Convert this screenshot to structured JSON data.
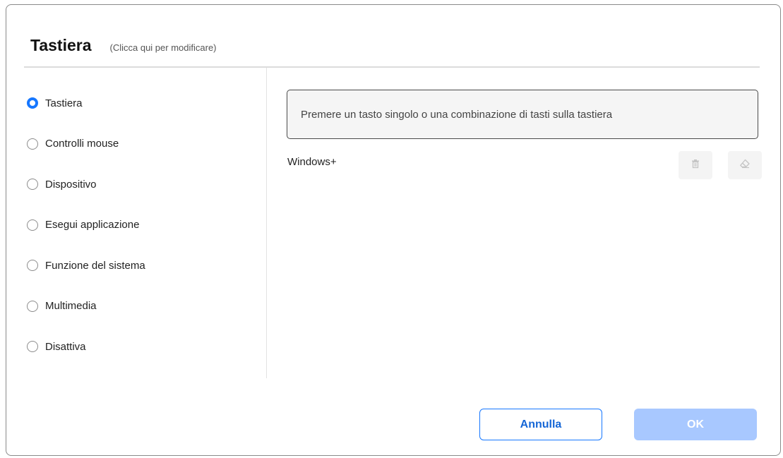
{
  "header": {
    "title": "Tastiera",
    "hint": "(Clicca qui per modificare)"
  },
  "options": [
    {
      "label": "Tastiera",
      "checked": true
    },
    {
      "label": "Controlli mouse",
      "checked": false
    },
    {
      "label": "Dispositivo",
      "checked": false
    },
    {
      "label": "Esegui applicazione",
      "checked": false
    },
    {
      "label": "Funzione del sistema",
      "checked": false
    },
    {
      "label": "Multimedia",
      "checked": false
    },
    {
      "label": "Disattiva",
      "checked": false
    }
  ],
  "key_input": {
    "placeholder": "Premere un tasto singolo o una combinazione di tasti sulla tastiera"
  },
  "key_value": "Windows+",
  "icons": {
    "delete": "trash-icon",
    "clear": "eraser-icon"
  },
  "buttons": {
    "cancel_label": "Annulla",
    "ok_label": "OK"
  },
  "colors": {
    "accent": "#1677ff",
    "ok_disabled": "#a8c8ff"
  }
}
